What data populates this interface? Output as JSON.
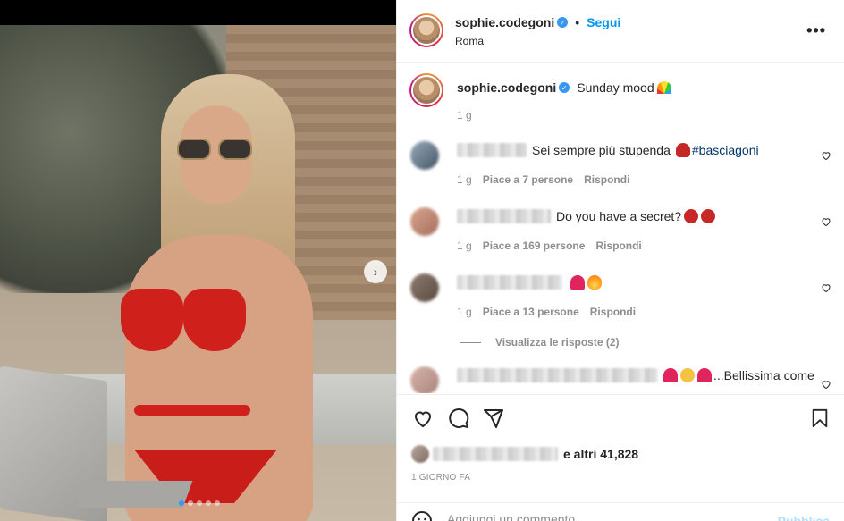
{
  "post": {
    "username": "sophie.codegoni",
    "separator": "•",
    "follow_label": "Segui",
    "location": "Roma",
    "more_label": "•••"
  },
  "caption": {
    "username": "sophie.codegoni",
    "text": "Sunday mood",
    "time": "1 g"
  },
  "comments": [
    {
      "text": "Sei sempre più stupenda",
      "hashtag": "#basciagoni",
      "time": "1 g",
      "likes": "Piace a 7 persone",
      "reply_label": "Rispondi"
    },
    {
      "text": "Do you have a secret?",
      "time": "1 g",
      "likes": "Piace a 169 persone",
      "reply_label": "Rispondi"
    },
    {
      "text": "",
      "time": "1 g",
      "likes": "Piace a 13 persone",
      "reply_label": "Rispondi"
    },
    {
      "text": "...Bellissima come"
    }
  ],
  "view_replies_label": "Visualizza le risposte (2)",
  "likes_summary": "e altri 41,828",
  "post_date": "1 GIORNO FA",
  "comment_input": {
    "placeholder": "Aggiungi un commento...",
    "publish_label": "Pubblica"
  },
  "carousel": {
    "slide_count": 5,
    "active_index": 0
  },
  "colors": {
    "accent": "#0095f6",
    "verified": "#3897f0",
    "bikini": "#d0201c"
  },
  "icons": [
    "more-icon",
    "verified-icon",
    "heart-icon",
    "comment-icon",
    "share-icon",
    "bookmark-icon",
    "smile-icon",
    "chevron-right-icon"
  ]
}
